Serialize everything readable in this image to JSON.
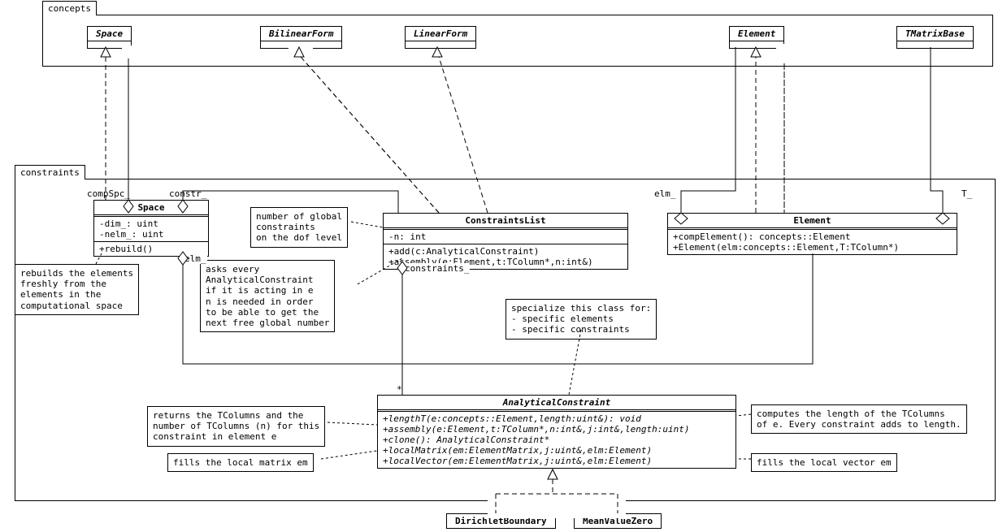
{
  "packages": {
    "concepts": {
      "label": "concepts"
    },
    "constraints": {
      "label": "constraints"
    }
  },
  "classes": {
    "c_space": {
      "name": "Space"
    },
    "c_bilinear": {
      "name": "BilinearForm"
    },
    "c_linear": {
      "name": "LinearForm"
    },
    "c_element": {
      "name": "Element"
    },
    "c_tmatrix": {
      "name": "TMatrixBase"
    },
    "k_space": {
      "name": "Space",
      "attrs": "-dim_: uint\n-nelm_: uint",
      "ops": "+rebuild()"
    },
    "k_constraints": {
      "name": "ConstraintsList",
      "attrs": "-n: int",
      "ops": "+add(c:AnalyticalConstraint)\n+assembly(e:Element,t:TColumn*,n:int&)"
    },
    "k_element": {
      "name": "Element",
      "ops": "+compElement(): concepts::Element\n+Element(elm:concepts::Element,T:TColumn*)"
    },
    "k_analytical": {
      "name": "AnalyticalConstraint",
      "ops": "+lengthT(e:concepts::Element,length:uint&): void\n+assembly(e:Element,t:TColumn*,n:int&,j:int&,length:uint)\n+clone(): AnalyticalConstraint*\n+localMatrix(em:ElementMatrix,j:uint&,elm:Element)\n+localVector(em:ElementMatrix,j:uint&,elm:Element)"
    },
    "k_dirichlet": {
      "name": "DirichletBoundary"
    },
    "k_meanvalue": {
      "name": "MeanValueZero"
    }
  },
  "notes": {
    "n_rebuild": "rebuilds the elements\nfreshly from the\nelements in the\ncomputational space",
    "n_number": "number of global\nconstraints\non the dof level",
    "n_asks": "asks every\nAnalyticalConstraint\nif it is acting in e\nn is needed in order\nto be able to get the\nnext free global number",
    "n_specialize": "specialize this class for:\n- specific elements\n- specific constraints",
    "n_returns": "returns the TColumns and the\nnumber of TColumns (n) for this\nconstraint in element e",
    "n_length": "computes the length of the TColumns\nof e. Every constraint adds to length.",
    "n_fillmat": "fills the local matrix em",
    "n_fillvec": "fills the local vector em"
  },
  "roles": {
    "compSpc": "compSpc_",
    "constr": "constr_",
    "elm": "elm_",
    "elm2": "elm_",
    "star": "*",
    "T": "T_",
    "constraints": "constraints_"
  }
}
